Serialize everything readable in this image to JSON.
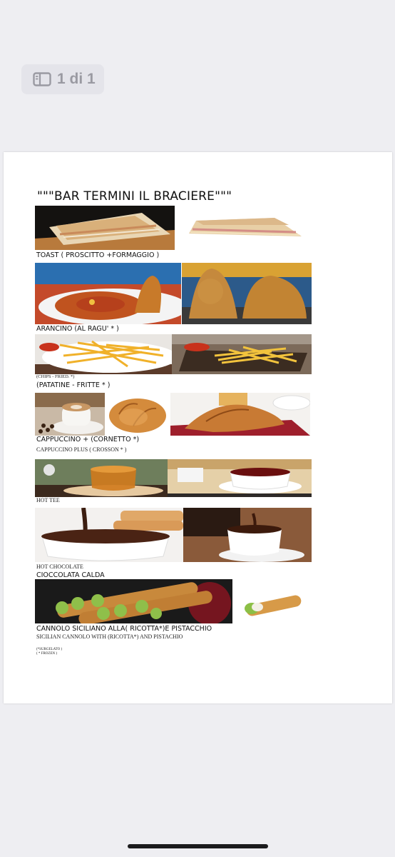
{
  "viewer": {
    "page_indicator": "1 di 1",
    "icon": "sidebar-icon"
  },
  "menu": {
    "title": "\"\"\"BAR TERMINI IL BRACIERE\"\"\"",
    "items": {
      "toast": {
        "label": "TOAST ( PROSCITTO +FORMAGGIO )"
      },
      "arancino": {
        "label": "ARANCINO (AL RAGU' * )"
      },
      "patatine": {
        "label_en": "(CHIPS - FRIED. *)",
        "label": "(PATATINE - FRITTE * )"
      },
      "cappuccino": {
        "label": "CAPPUCCINO + (CORNETTO *)",
        "label_en": "CAPPUCCINO PLUS ( CROSSON * )"
      },
      "tea": {
        "label_en": "HOT TEE"
      },
      "cioccolata": {
        "label_en": "HOT CHOCOLATE",
        "label": "CIOCCOLATA CALDA"
      },
      "cannolo": {
        "label": "CANNOLO SICILIANO ALLA( RICOTTA*)E PISTACCHIO",
        "label_en": "SICILIAN CANNOLO WITH (RICOTTA*) AND PISTACHIO"
      }
    },
    "notes": {
      "surgelato": "(*SURGELATO )",
      "frozen": "( * FROZEN )"
    }
  }
}
